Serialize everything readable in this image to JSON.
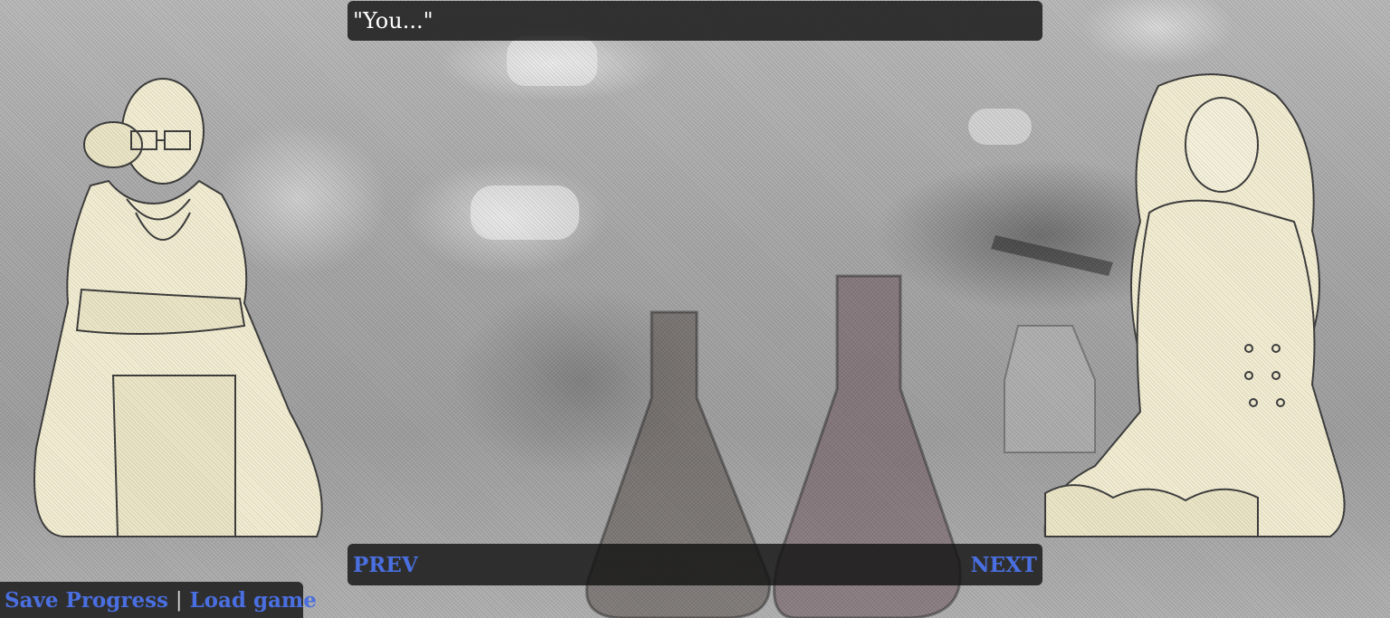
{
  "dialogue": {
    "text": "\"You...\""
  },
  "navigation": {
    "prev_label": "PREV",
    "next_label": "NEXT"
  },
  "menu": {
    "save_label": "Save Progress",
    "separator": "|",
    "load_label": "Load game"
  },
  "colors": {
    "link": "#4a6fe0",
    "panel": "#141414",
    "sprite_fill": "#f3eed2"
  },
  "scene": {
    "background": "laboratory with glass flasks",
    "left_character": "woman in lab coat with glasses, arms crossed",
    "right_character": "woman with curly hair in frilled jacket"
  }
}
